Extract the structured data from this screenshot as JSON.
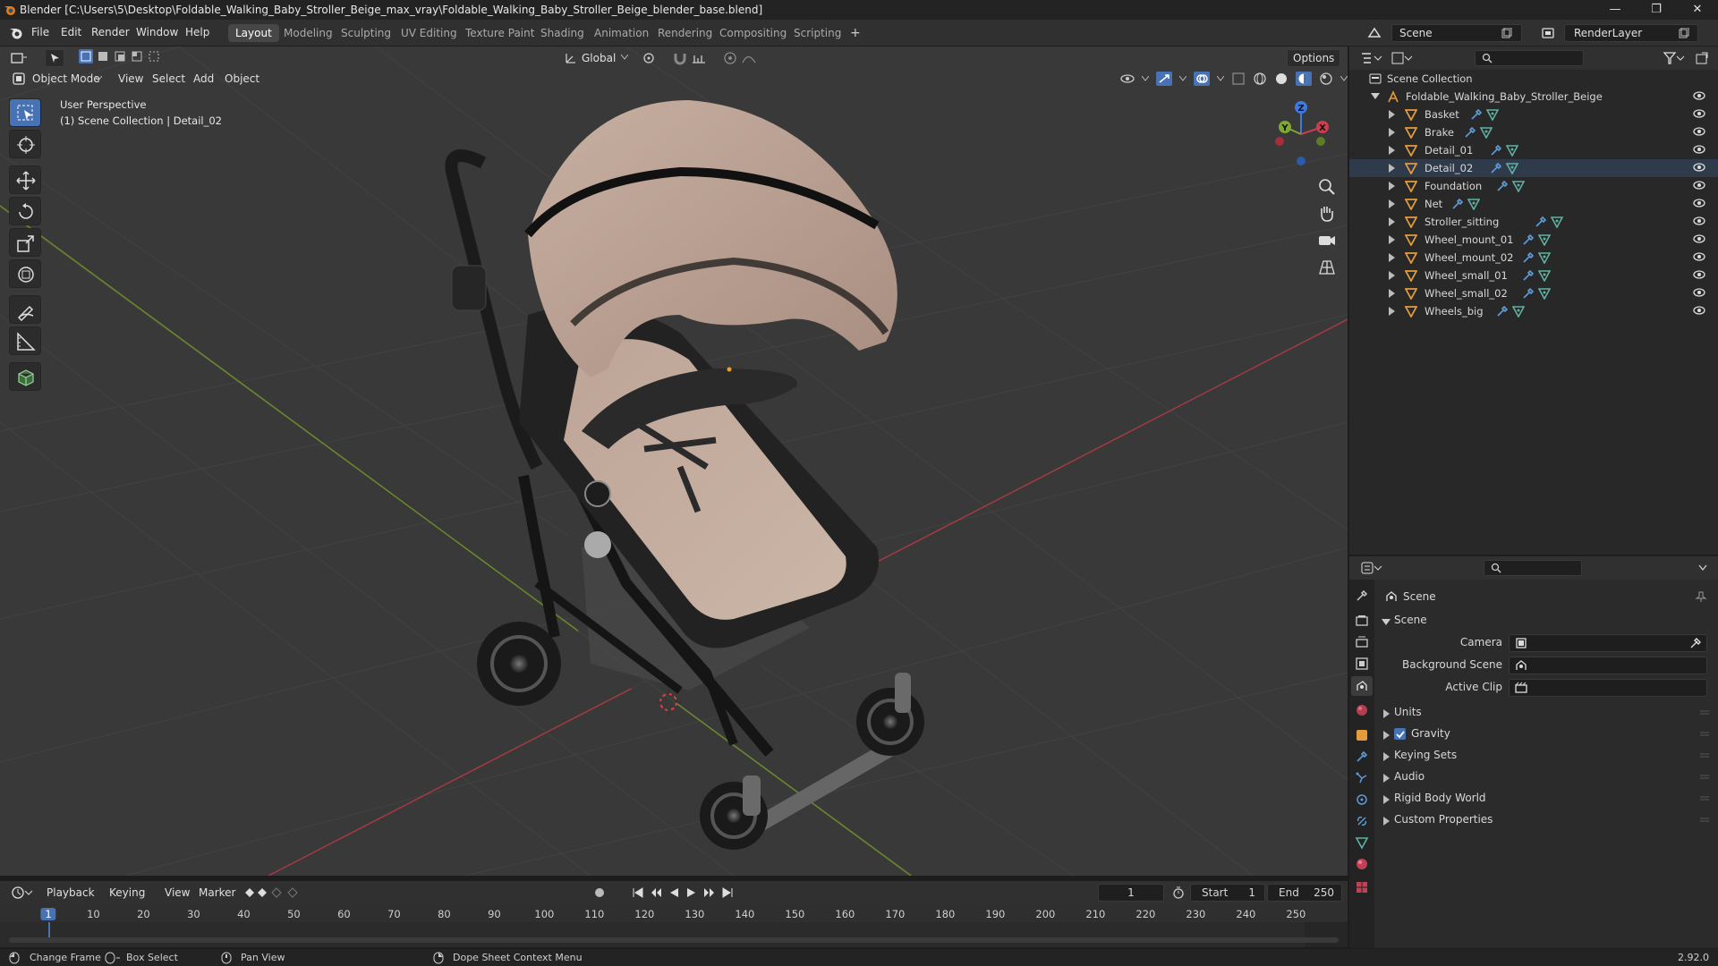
{
  "titlebar": {
    "title": "Blender [C:\\Users\\5\\Desktop\\Foldable_Walking_Baby_Stroller_Beige_max_vray\\Foldable_Walking_Baby_Stroller_Beige_blender_base.blend]",
    "minimize": "—",
    "maximize": "❐",
    "close": "✕"
  },
  "menu": {
    "items": [
      "File",
      "Edit",
      "Render",
      "Window",
      "Help"
    ],
    "workspaces": [
      "Layout",
      "Modeling",
      "Sculpting",
      "UV Editing",
      "Texture Paint",
      "Shading",
      "Animation",
      "Rendering",
      "Compositing",
      "Scripting"
    ],
    "add_tab": "+",
    "scene_name": "Scene",
    "render_layer": "RenderLayer"
  },
  "viewport": {
    "mode": "Object Mode",
    "menus": [
      "View",
      "Select",
      "Add",
      "Object"
    ],
    "transform_orientation": "Global",
    "options": "Options",
    "info_line1": "User Perspective",
    "info_line2": "(1) Scene Collection | Detail_02",
    "gizmo": {
      "x": "X",
      "y": "Y",
      "z": "Z"
    }
  },
  "outliner": {
    "root": "Scene Collection",
    "collection": "Foldable_Walking_Baby_Stroller_Beige",
    "objects": [
      "Basket",
      "Brake",
      "Detail_01",
      "Detail_02",
      "Foundation",
      "Net",
      "Stroller_sitting",
      "Wheel_mount_01",
      "Wheel_mount_02",
      "Wheel_small_01",
      "Wheel_small_02",
      "Wheels_big"
    ]
  },
  "properties": {
    "context": "Scene",
    "panel": "Scene",
    "fields": {
      "camera": "Camera",
      "background_scene": "Background Scene",
      "active_clip": "Active Clip"
    },
    "subpanels": [
      "Units",
      "Gravity",
      "Keying Sets",
      "Audio",
      "Rigid Body World",
      "Custom Properties"
    ],
    "gravity_checked": true
  },
  "timeline": {
    "menus": [
      "Playback",
      "Keying",
      "View",
      "Marker"
    ],
    "current_frame": "1",
    "start_label": "Start",
    "start": "1",
    "end_label": "End",
    "end": "250",
    "ruler": [
      "1",
      "10",
      "20",
      "30",
      "40",
      "50",
      "60",
      "70",
      "80",
      "90",
      "100",
      "110",
      "120",
      "130",
      "140",
      "150",
      "160",
      "170",
      "180",
      "190",
      "200",
      "210",
      "220",
      "230",
      "240",
      "250"
    ]
  },
  "statusbar": {
    "change_frame": "Change Frame",
    "box_select": "Box Select",
    "pan_view": "Pan View",
    "context_menu": "Dope Sheet Context Menu",
    "version": "2.92.0"
  },
  "colors": {
    "accent": "#4772b3",
    "x_axis": "#c8404d",
    "y_axis": "#7fa832",
    "z_axis": "#3d7be0",
    "fabric": "#b59c8e",
    "frame": "#1a1a1a",
    "mesh_icon": "#e39b3c",
    "data_icon": "#5fb1a3"
  }
}
